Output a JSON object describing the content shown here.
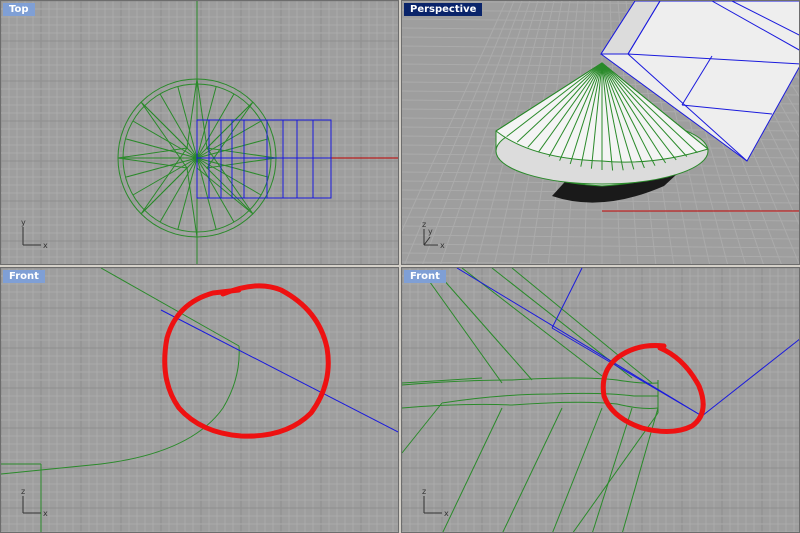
{
  "viewports": {
    "top": {
      "label": "Top",
      "active": false
    },
    "perspective": {
      "label": "Perspective",
      "active": true
    },
    "front_left": {
      "label": "Front",
      "active": false
    },
    "front_right": {
      "label": "Front",
      "active": false
    }
  },
  "axis_letters": {
    "x": "x",
    "y": "y",
    "z": "z"
  },
  "colors": {
    "viewport_bg": "#9e9e9e",
    "grid_minor": "#ababab",
    "grid_major": "#8c8c8c",
    "geometry_green": "#2a8a2a",
    "box_blue": "#1a1add",
    "axis_red": "#c00000",
    "annotation_red": "#ee1111",
    "label_inactive": "#7f9fd5",
    "label_active": "#0a246a"
  }
}
